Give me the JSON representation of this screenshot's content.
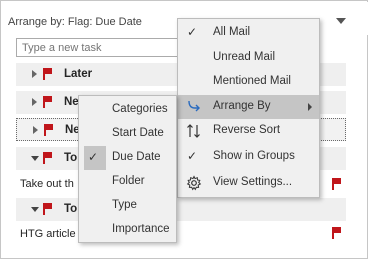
{
  "header": {
    "arrange_label": "Arrange by: Flag: Due Date"
  },
  "task_input": {
    "placeholder": "Type a new task"
  },
  "groups": [
    {
      "label": "Later"
    },
    {
      "label": "Ne"
    },
    {
      "label": "Ne"
    },
    {
      "label": "To"
    },
    {
      "label": "To"
    }
  ],
  "tasks": [
    {
      "label": "Take out th"
    },
    {
      "label": "HTG article"
    }
  ],
  "main_menu": {
    "items": [
      {
        "label": "All Mail",
        "checked": true
      },
      {
        "label": "Unread Mail"
      },
      {
        "label": "Mentioned Mail"
      },
      {
        "label": "Arrange By",
        "icon": "arrange-by-icon",
        "submenu": true
      },
      {
        "label": "Reverse Sort",
        "icon": "reverse-sort-icon"
      },
      {
        "label": "Show in Groups",
        "checked": true
      },
      {
        "label": "View Settings...",
        "icon": "gear-icon"
      }
    ]
  },
  "arrange_submenu": {
    "items": [
      {
        "label": "Categories"
      },
      {
        "label": "Start Date"
      },
      {
        "label": "Due Date",
        "checked": true
      },
      {
        "label": "Folder"
      },
      {
        "label": "Type"
      },
      {
        "label": "Importance"
      }
    ]
  },
  "colors": {
    "flag_red": "#c0161b",
    "menu_bg": "#f0f0f0",
    "menu_highlight": "#c5c5c5",
    "group_row_bg": "#efefef"
  }
}
